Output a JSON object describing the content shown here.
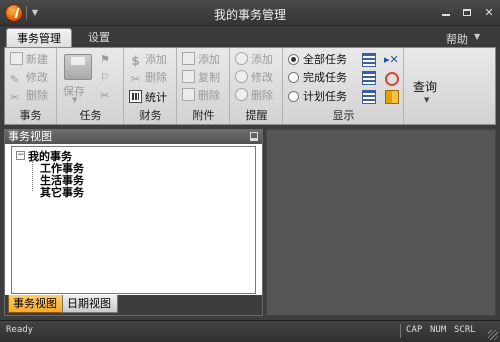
{
  "window": {
    "title": "我的事务管理"
  },
  "tabs": {
    "active": "事务管理",
    "settings": "设置",
    "help": "帮助"
  },
  "ribbon": {
    "affairs": {
      "label": "事务",
      "new": "新建",
      "edit": "修改",
      "delete": "删除"
    },
    "tasks": {
      "label": "任务",
      "save": "保存"
    },
    "finance": {
      "label": "财务",
      "add": "添加",
      "delete": "删除",
      "stats": "统计"
    },
    "attachments": {
      "label": "附件",
      "add": "添加",
      "copy": "复制",
      "delete": "删除"
    },
    "reminders": {
      "label": "提醒",
      "add": "添加",
      "edit": "修改",
      "delete": "删除"
    },
    "display": {
      "label": "显示",
      "all": "全部任务",
      "done": "完成任务",
      "planned": "计划任务"
    },
    "query": {
      "label": "查询"
    }
  },
  "panel": {
    "title": "事务视图",
    "tree": {
      "root": "我的事务",
      "children": [
        "工作事务",
        "生活事务",
        "其它事务"
      ]
    },
    "bottom_tabs": [
      "事务视图",
      "日期视图"
    ]
  },
  "status": {
    "text": "Ready",
    "indicators": [
      "CAP",
      "NUM",
      "SCRL"
    ]
  }
}
